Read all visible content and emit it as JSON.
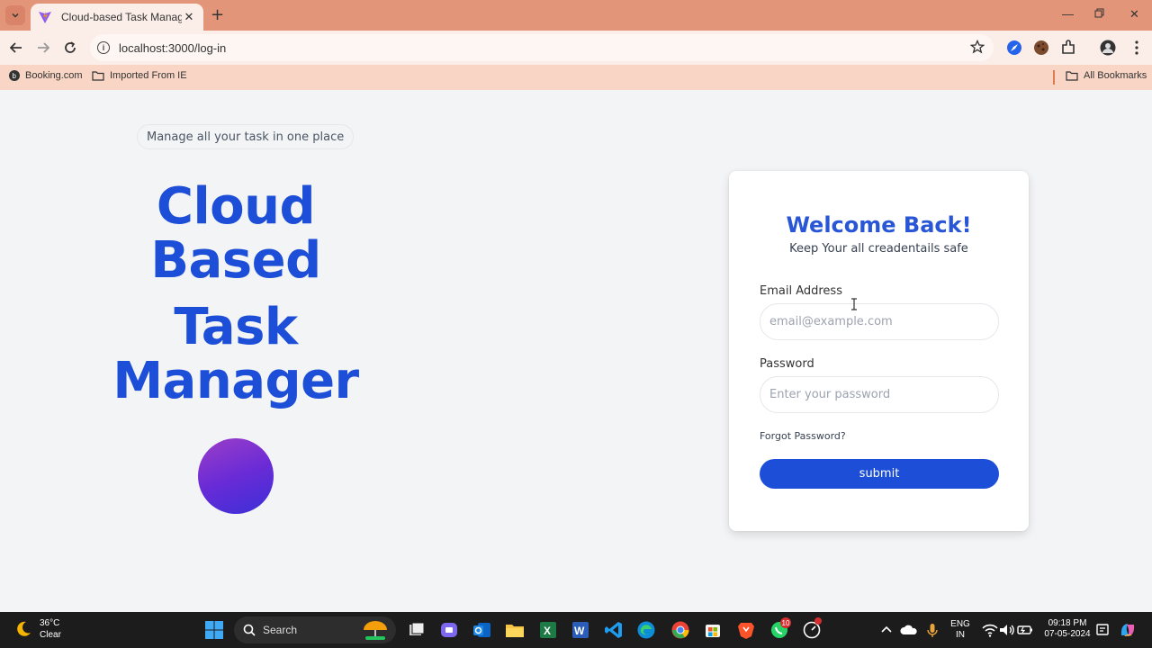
{
  "browser": {
    "tab_title": "Cloud-based Task Manager",
    "url": "localhost:3000/log-in",
    "bookmarks": [
      {
        "label": "Booking.com"
      },
      {
        "label": "Imported From IE"
      }
    ],
    "all_bookmarks_label": "All Bookmarks"
  },
  "page": {
    "tagline": "Manage all your task in one place",
    "hero_line1": "Cloud",
    "hero_line2": "Based",
    "hero_line3": "Task",
    "hero_line4": "Manager",
    "login": {
      "title": "Welcome Back!",
      "subtitle": "Keep Your all creadentails safe",
      "email_label": "Email Address",
      "email_placeholder": "email@example.com",
      "email_value": "",
      "password_label": "Password",
      "password_placeholder": "Enter your password",
      "password_value": "",
      "forgot_label": "Forgot Password?",
      "submit_label": "submit"
    }
  },
  "taskbar": {
    "weather_temp": "36°C",
    "weather_desc": "Clear",
    "search_label": "Search",
    "whatsapp_badge": "10",
    "lang_line1": "ENG",
    "lang_line2": "IN",
    "time": "09:18 PM",
    "date": "07-05-2024"
  },
  "colors": {
    "accent": "#1d4ed8",
    "tabbar": "#e3957a",
    "bookmarks_bar": "#f8d5c5"
  }
}
